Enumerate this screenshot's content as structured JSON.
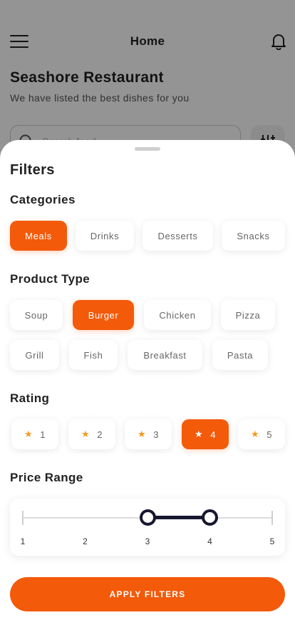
{
  "header": {
    "title": "Home"
  },
  "restaurant": {
    "name": "Seashore Restaurant",
    "subtitle": "We have listed the best dishes for you"
  },
  "search": {
    "placeholder": "Search food"
  },
  "filters": {
    "title": "Filters",
    "categories": {
      "title": "Categories",
      "items": [
        {
          "label": "Meals",
          "selected": true
        },
        {
          "label": "Drinks",
          "selected": false
        },
        {
          "label": "Desserts",
          "selected": false
        },
        {
          "label": "Snacks",
          "selected": false
        }
      ]
    },
    "product_type": {
      "title": "Product Type",
      "items": [
        {
          "label": "Soup",
          "selected": false
        },
        {
          "label": "Burger",
          "selected": true
        },
        {
          "label": "Chicken",
          "selected": false
        },
        {
          "label": "Pizza",
          "selected": false
        },
        {
          "label": "Grill",
          "selected": false
        },
        {
          "label": "Fish",
          "selected": false
        },
        {
          "label": "Breakfast",
          "selected": false
        },
        {
          "label": "Pasta",
          "selected": false
        }
      ]
    },
    "rating": {
      "title": "Rating",
      "items": [
        {
          "label": "1",
          "selected": false
        },
        {
          "label": "2",
          "selected": false
        },
        {
          "label": "3",
          "selected": false
        },
        {
          "label": "4",
          "selected": true
        },
        {
          "label": "5",
          "selected": false
        }
      ]
    },
    "price_range": {
      "title": "Price Range",
      "min": 1,
      "max": 5,
      "selected_low": 3,
      "selected_high": 4,
      "tick_labels": [
        "1",
        "2",
        "3",
        "4",
        "5"
      ]
    },
    "apply_label": "APPLY FILTERS"
  },
  "icons": {
    "menu": "menu-icon",
    "notification": "bell-icon",
    "search": "search-icon",
    "filter": "sliders-icon",
    "rating": "star-icon"
  },
  "colors": {
    "accent": "#f35a0a",
    "star": "#f39a1e",
    "slider": "#171730"
  }
}
